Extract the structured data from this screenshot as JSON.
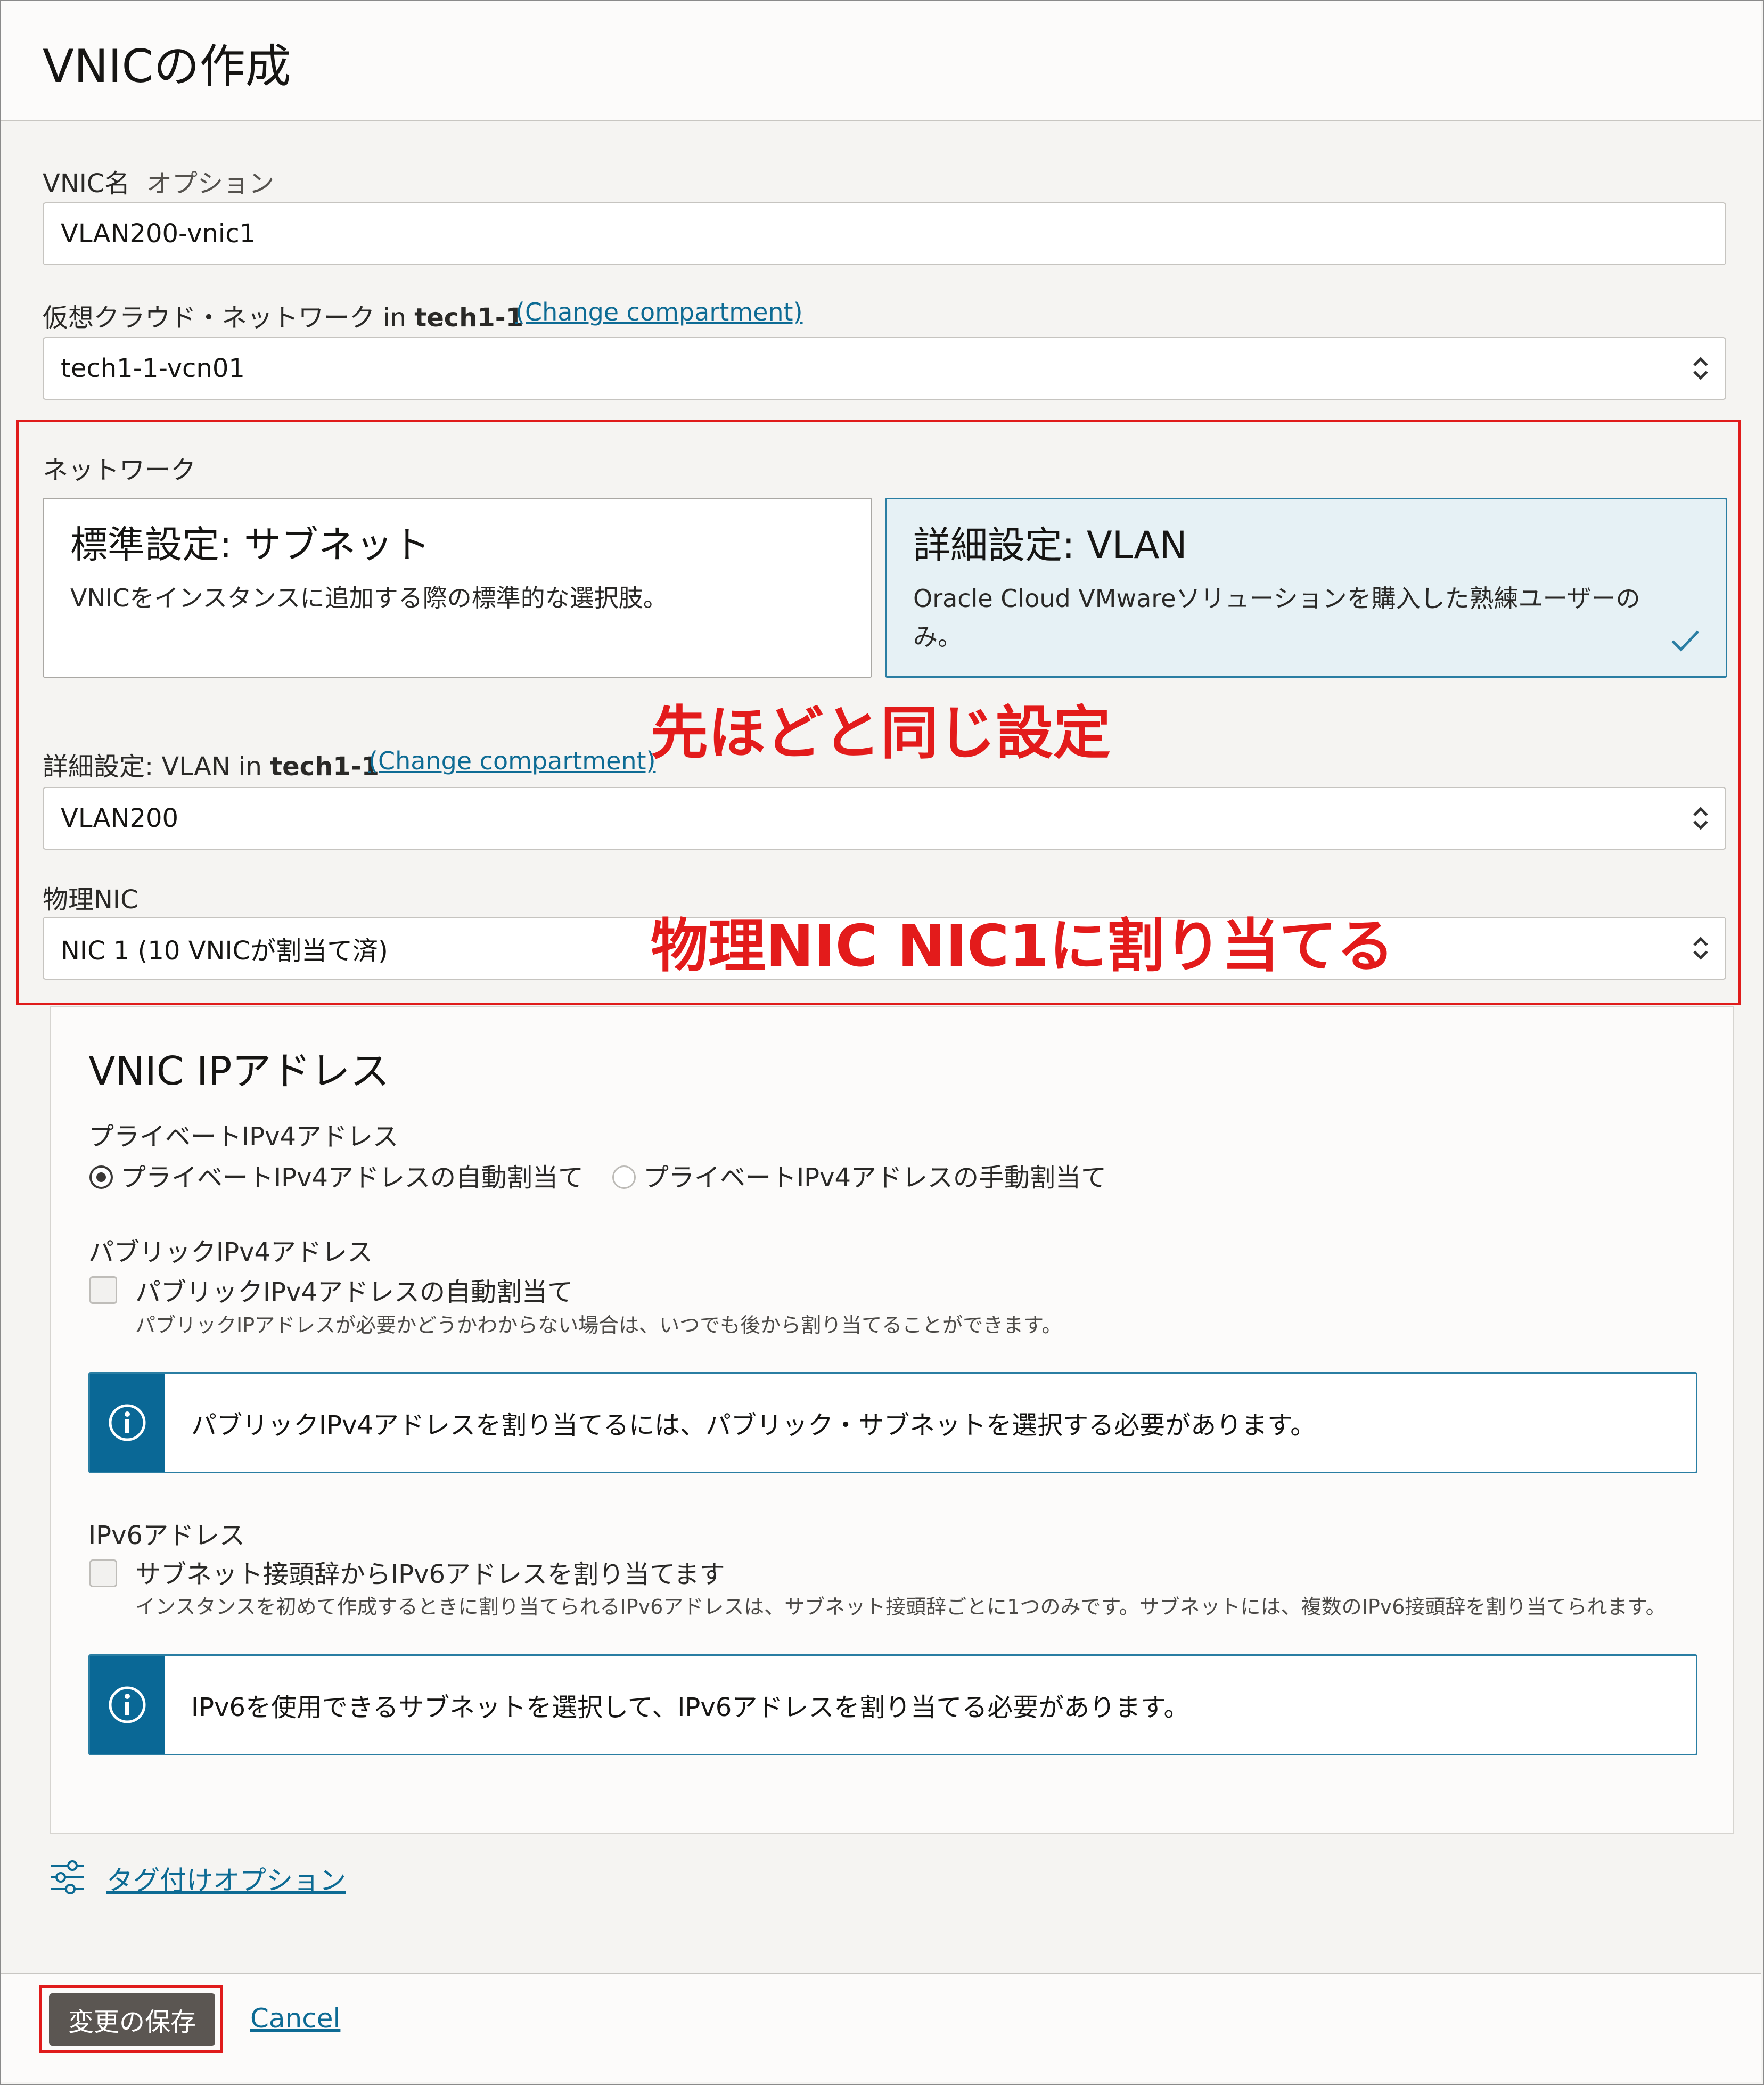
{
  "header": {
    "title": "VNICの作成"
  },
  "vnic_name": {
    "label": "VNIC名",
    "optional": "オプション",
    "value": "VLAN200-vnic1"
  },
  "vcn": {
    "label_prefix": "仮想クラウド・ネットワーク in ",
    "compartment": "tech1-1",
    "change_link": "(Change compartment)",
    "value": "tech1-1-vcn01"
  },
  "network": {
    "label": "ネットワーク",
    "standard": {
      "title": "標準設定: サブネット",
      "desc": "VNICをインスタンスに追加する際の標準的な選択肢。"
    },
    "advanced": {
      "title": "詳細設定: VLAN",
      "desc_line1": "Oracle Cloud VMwareソリューションを購入した熟練ユーザーの",
      "desc_line2": "み。",
      "selected": true
    }
  },
  "vlan": {
    "label_prefix": "詳細設定: VLAN in ",
    "compartment": "tech1-1",
    "change_link": "(Change compartment)",
    "value": "VLAN200"
  },
  "physical_nic": {
    "label": "物理NIC",
    "value": "NIC 1 (10 VNICが割当て済)"
  },
  "annotations": {
    "same_settings": "先ほどと同じ設定",
    "assign_nic": "物理NIC NIC1に割り当てる"
  },
  "ip": {
    "title": "VNIC IPアドレス",
    "private_label": "プライベートIPv4アドレス",
    "private_auto": "プライベートIPv4アドレスの自動割当て",
    "private_manual": "プライベートIPv4アドレスの手動割当て",
    "private_selected": "auto",
    "public_label": "パブリックIPv4アドレス",
    "public_checkbox": "パブリックIPv4アドレスの自動割当て",
    "public_help": "パブリックIPアドレスが必要かどうかわからない場合は、いつでも後から割り当てることができます。",
    "public_info": "パブリックIPv4アドレスを割り当てるには、パブリック・サブネットを選択する必要があります。",
    "ipv6_label": "IPv6アドレス",
    "ipv6_checkbox": "サブネット接頭辞からIPv6アドレスを割り当てます",
    "ipv6_help": "インスタンスを初めて作成するときに割り当てられるIPv6アドレスは、サブネット接頭辞ごとに1つのみです。サブネットには、複数のIPv6接頭辞を割り当てられます。",
    "ipv6_info": "IPv6を使用できるサブネットを選択して、IPv6アドレスを割り当てる必要があります。"
  },
  "tagging": {
    "link": "タグ付けオプション"
  },
  "footer": {
    "save": "変更の保存",
    "cancel": "Cancel"
  },
  "colors": {
    "accent": "#0a6896",
    "annotation_red": "#e01b1b",
    "save_button": "#5b5652"
  },
  "icons": [
    "chevron-updown-icon",
    "check-icon",
    "info-icon",
    "tag-options-icon"
  ]
}
